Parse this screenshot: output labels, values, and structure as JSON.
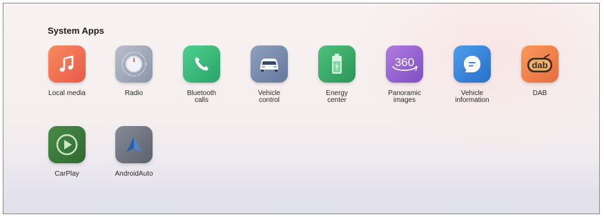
{
  "section": {
    "title": "System Apps"
  },
  "apps": [
    {
      "label_line1": "Local media",
      "label_line2": "",
      "icon": "music-note-icon",
      "color": "#ef6d52"
    },
    {
      "label_line1": "Radio",
      "label_line2": "",
      "icon": "radio-dial-icon",
      "color": "#9aa4b8"
    },
    {
      "label_line1": "Bluetooth",
      "label_line2": "calls",
      "icon": "phone-icon",
      "color": "#3fbf7f"
    },
    {
      "label_line1": "Vehicle",
      "label_line2": "control",
      "icon": "car-icon",
      "color": "#7a8fb0"
    },
    {
      "label_line1": "Energy",
      "label_line2": "center",
      "icon": "battery-icon",
      "color": "#3fb06a"
    },
    {
      "label_line1": "Panoramic",
      "label_line2": "images",
      "icon": "panorama-360-icon",
      "color": "#9b6bd0"
    },
    {
      "label_line1": "Vehicle",
      "label_line2": "information",
      "icon": "chat-bubble-icon",
      "color": "#3a86d8"
    },
    {
      "label_line1": "DAB",
      "label_line2": "",
      "icon": "dab-radio-icon",
      "color": "#f07e4c"
    },
    {
      "label_line1": "CarPlay",
      "label_line2": "",
      "icon": "carplay-play-icon",
      "color": "#3e7a3e"
    },
    {
      "label_line1": "AndroidAuto",
      "label_line2": "",
      "icon": "android-auto-icon",
      "color": "#6f7580"
    }
  ]
}
